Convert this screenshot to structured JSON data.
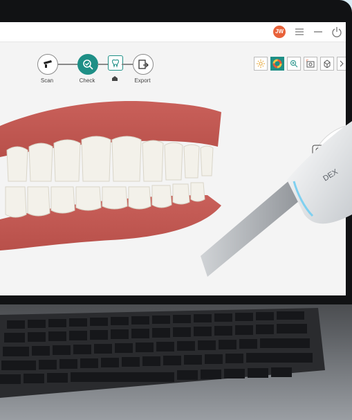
{
  "topbar": {
    "avatar_initials": "JW",
    "menu_icon": "hamburger-menu-icon",
    "minimize_icon": "minimize-icon",
    "power_icon": "power-icon"
  },
  "workflow": {
    "steps": [
      {
        "label": "Scan",
        "icon": "scanner-icon"
      },
      {
        "label": "Check",
        "icon": "check-magnify-icon",
        "active": true
      },
      {
        "label": "",
        "icon": "tooth-icon"
      },
      {
        "label": "Export",
        "icon": "export-icon"
      }
    ]
  },
  "toolbar": {
    "tools": [
      "brightness-icon",
      "color-wheel-icon",
      "zoom-icon",
      "screenshot-icon",
      "3d-view-icon",
      "chevron-right-icon"
    ],
    "active_tool": "color-wheel-icon"
  },
  "badge": {
    "label": "F"
  },
  "scanner_brand": "DEX",
  "colors": {
    "accent": "#1e8f86",
    "brand": "#e8623a"
  }
}
